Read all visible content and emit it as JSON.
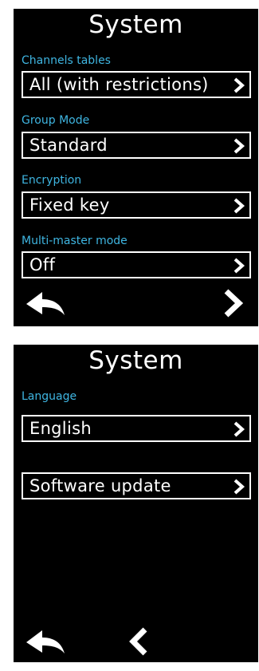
{
  "screens": [
    {
      "title": "System",
      "rows": [
        {
          "label": "Channels tables",
          "value": "All (with restrictions)"
        },
        {
          "label": "Group Mode",
          "value": "Standard"
        },
        {
          "label": "Encryption",
          "value": "Fixed key"
        },
        {
          "label": "Multi-master mode",
          "value": "Off"
        }
      ],
      "nav": {
        "back": "back-arrow-icon",
        "next": "chevron-right-icon"
      }
    },
    {
      "title": "System",
      "rows": [
        {
          "label": "Language",
          "value": "English"
        },
        {
          "label": "",
          "value": "Software update"
        }
      ],
      "nav": {
        "back": "back-arrow-icon",
        "prev": "chevron-left-icon"
      }
    }
  ],
  "colors": {
    "background": "#000000",
    "text": "#ffffff",
    "label": "#3fb6e2"
  }
}
